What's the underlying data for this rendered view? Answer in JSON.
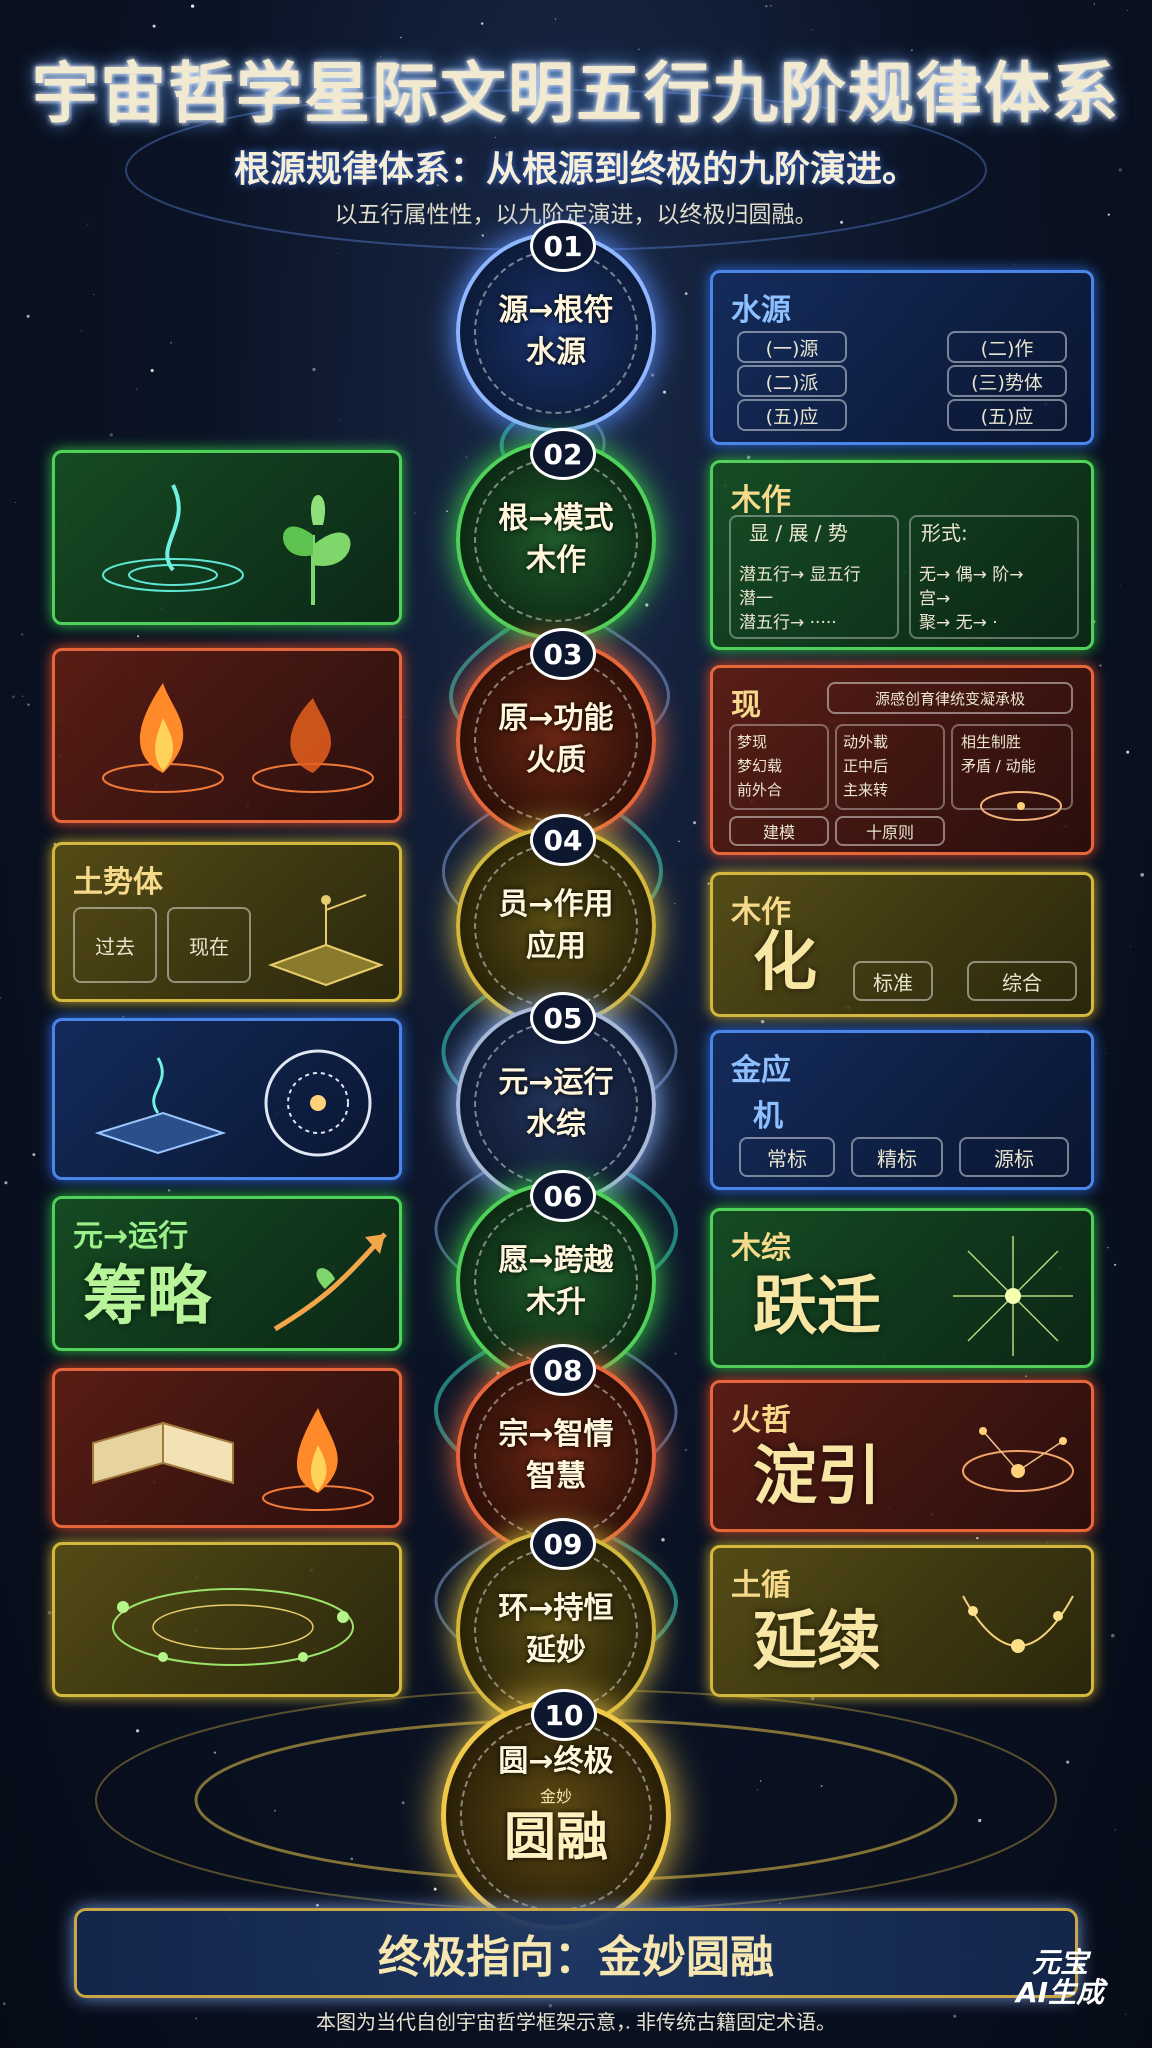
{
  "header": {
    "title": "宇宙哲学星际文明五行九阶规律体系",
    "subtitle": "根源规律体系：从根源到终极的九阶演进。",
    "description": "以五行属性性，以九阶定演进，以终极归圆融。"
  },
  "colors": {
    "water": "#4a86e8",
    "wood": "#4fd15a",
    "fire": "#e5663a",
    "earth": "#d4b83e",
    "gold": "#f0c84a"
  },
  "stages": [
    {
      "num": "01",
      "line1": "源→根符",
      "line2": "水源",
      "element": "water"
    },
    {
      "num": "02",
      "line1": "根→模式",
      "line2": "木作",
      "element": "wood"
    },
    {
      "num": "03",
      "line1": "原→功能",
      "line2": "火质",
      "element": "fire"
    },
    {
      "num": "04",
      "line1": "员→作用",
      "line2": "应用",
      "element": "earth"
    },
    {
      "num": "05",
      "line1": "元→运行",
      "line2": "水综",
      "element": "water"
    },
    {
      "num": "06",
      "line1": "愿→跨越",
      "line2": "木升",
      "element": "wood"
    },
    {
      "num": "08",
      "line1": "宗→智情",
      "line2": "智慧",
      "element": "fire"
    },
    {
      "num": "09",
      "line1": "环→持恒",
      "line2": "延妙",
      "element": "earth"
    },
    {
      "num": "10",
      "line1": "圆→终极",
      "line2": "圆融",
      "line1b": "金妙",
      "element": "gold"
    }
  ],
  "right_panels": {
    "p1": {
      "title": "水源",
      "chips": [
        "(一)源",
        "(二)作",
        "(二)派",
        "(三)势体",
        "(五)应",
        "(五)应"
      ]
    },
    "p2": {
      "title": "木作",
      "tags": "显 / 展 / 势",
      "form_label": "形式:",
      "left_lines": [
        "潜五行→ 显五行",
        "潜一",
        "潜五行→ ·····"
      ],
      "right_lines": [
        "无→ 偶→ 阶→",
        "宫→",
        "聚→ 无→ ·"
      ]
    },
    "p3": {
      "title": "现",
      "header_chip": "源感创育律统变凝承极",
      "col1": [
        "梦现",
        "梦幻载",
        "前外合"
      ],
      "col2": [
        "动外載",
        "正中后",
        "主来转"
      ],
      "col3": [
        "相生制胜",
        "矛盾 / 动能"
      ],
      "bottom": [
        "建模",
        "十原则"
      ]
    },
    "p4": {
      "title": "木作",
      "big": "化",
      "chips": [
        "标准",
        "综合"
      ]
    },
    "p5": {
      "title": "金应",
      "sub": "机",
      "chips": [
        "常标",
        "精标",
        "源标"
      ]
    },
    "p6": {
      "title": "木综",
      "big": "跃迁"
    },
    "p8": {
      "title": "火哲",
      "big": "淀引"
    },
    "p9": {
      "title": "土循",
      "big": "延续"
    }
  },
  "left_panels": {
    "p4": {
      "title": "土势体",
      "chips": [
        "过去",
        "现在"
      ]
    },
    "p6": {
      "title": "元→运行",
      "big": "筹略"
    }
  },
  "footer": {
    "banner": "终极指向：金妙圆融",
    "note": "本图为当代自创宇宙哲学框架示意，非传统古籍固定术语。",
    "brand_line1": "元宝",
    "brand_line2": "AI生成"
  }
}
